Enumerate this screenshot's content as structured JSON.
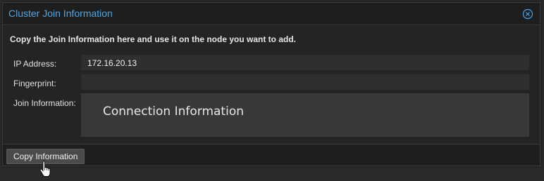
{
  "dialog": {
    "title": "Cluster Join Information",
    "close_icon": "close-circle-icon",
    "title_color": "#4da6e8"
  },
  "body": {
    "instructions": "Copy the Join Information here and use it on the node you want to add.",
    "fields": {
      "ip_address": {
        "label": "IP Address:",
        "value": "172.16.20.13"
      },
      "fingerprint": {
        "label": "Fingerprint:",
        "value": ""
      },
      "join_information": {
        "label": "Join Information:",
        "value": "Connection Information"
      }
    }
  },
  "footer": {
    "copy_button_label": "Copy Information"
  },
  "cursor": "hand-pointer-icon"
}
